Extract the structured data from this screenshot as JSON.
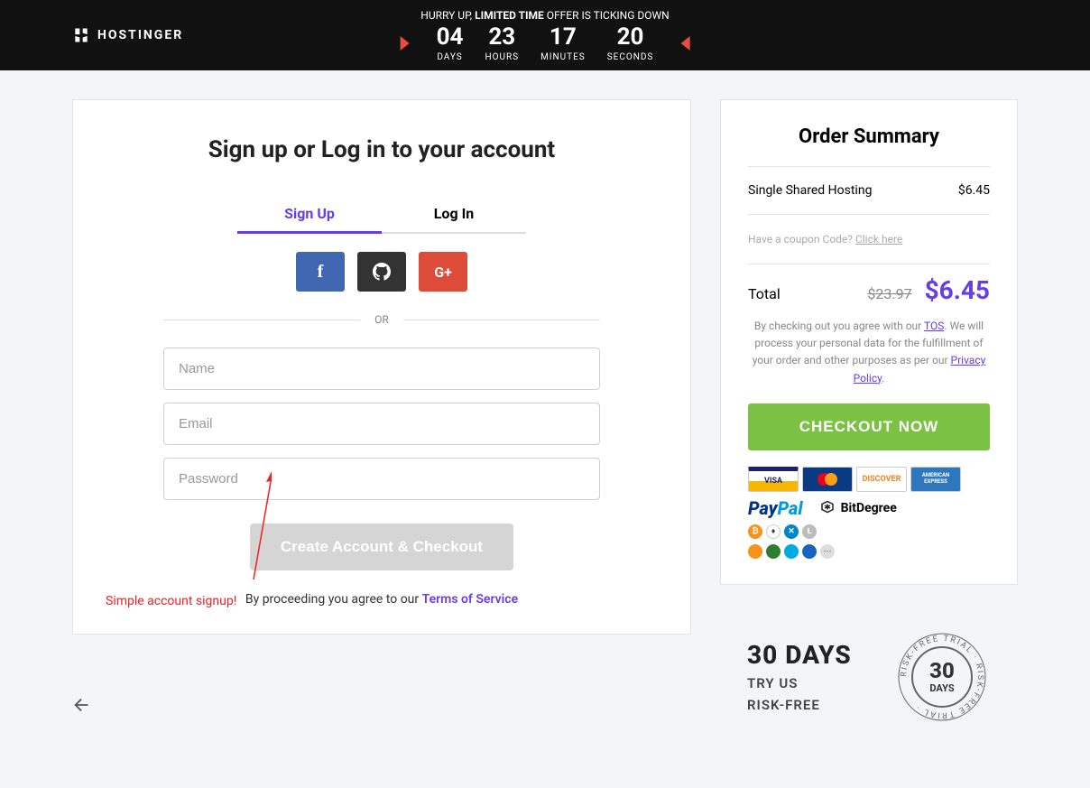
{
  "brand": "HOSTINGER",
  "promo": {
    "prefix": "HURRY UP, ",
    "bold": "LIMITED TIME",
    "suffix": " OFFER IS TICKING DOWN",
    "countdown": {
      "days": "04",
      "days_label": "DAYS",
      "hours": "23",
      "hours_label": "HOURS",
      "minutes": "17",
      "minutes_label": "MINUTES",
      "seconds": "20",
      "seconds_label": "SECONDS"
    }
  },
  "signup": {
    "title": "Sign up or Log in to your account",
    "tab_signup": "Sign Up",
    "tab_login": "Log In",
    "or": "OR",
    "name_placeholder": "Name",
    "email_placeholder": "Email",
    "password_placeholder": "Password",
    "create_btn": "Create Account & Checkout",
    "tos_prefix": "By proceeding you agree to our ",
    "tos_link": "Terms of Service",
    "annotation": "Simple account signup!"
  },
  "summary": {
    "heading": "Order Summary",
    "item_name": "Single Shared Hosting",
    "item_price": "$6.45",
    "coupon_text": "Have a coupon Code? ",
    "coupon_link": "Click here",
    "total_label": "Total",
    "old_price": "$23.97",
    "new_price": "$6.45",
    "legal_1": "By checking out you agree with our ",
    "legal_tos": "TOS",
    "legal_2": ". We will process your personal data for the fulfillment of your order and other purposes as per our ",
    "legal_privacy": "Privacy Policy",
    "legal_3": ".",
    "checkout_btn": "CHECKOUT NOW",
    "cards": {
      "visa": "VISA",
      "mastercard": "MasterCard",
      "discover": "DISCOVER",
      "amex": "AMERICAN EXPRESS"
    },
    "paypal_1": "Pay",
    "paypal_2": "Pal",
    "bitdegree": "BitDegree"
  },
  "trial": {
    "days": "30 DAYS",
    "line1": "TRY US",
    "line2": "RISK-FREE",
    "stamp_outer": "RISK-FREE TRIAL · RISK-FREE TRIAL · ",
    "stamp_num": "30",
    "stamp_days": "DAYS"
  }
}
